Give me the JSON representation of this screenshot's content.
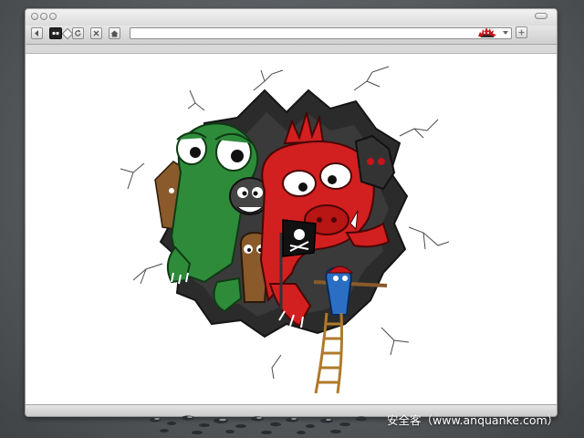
{
  "browser": {
    "address_bar": {
      "value": ""
    },
    "toolbar_icons": [
      "back-icon",
      "tab-icon",
      "reload-icon",
      "stop-icon",
      "home-icon",
      "pirate-mascot-icon",
      "dropdown-arrow-icon",
      "add-icon"
    ]
  },
  "page": {
    "illustration": "monster-crew-bursting-through-wall-icon"
  },
  "watermark": {
    "text": "安全客（www.anquanke.com）"
  },
  "colors": {
    "page_background": "#ffffff",
    "chrome": "#d9d9d9",
    "desktop": "#55595c",
    "green_monster": "#2e8b3a",
    "red_monster": "#d21f1f",
    "hole": "#2b2b2b"
  }
}
